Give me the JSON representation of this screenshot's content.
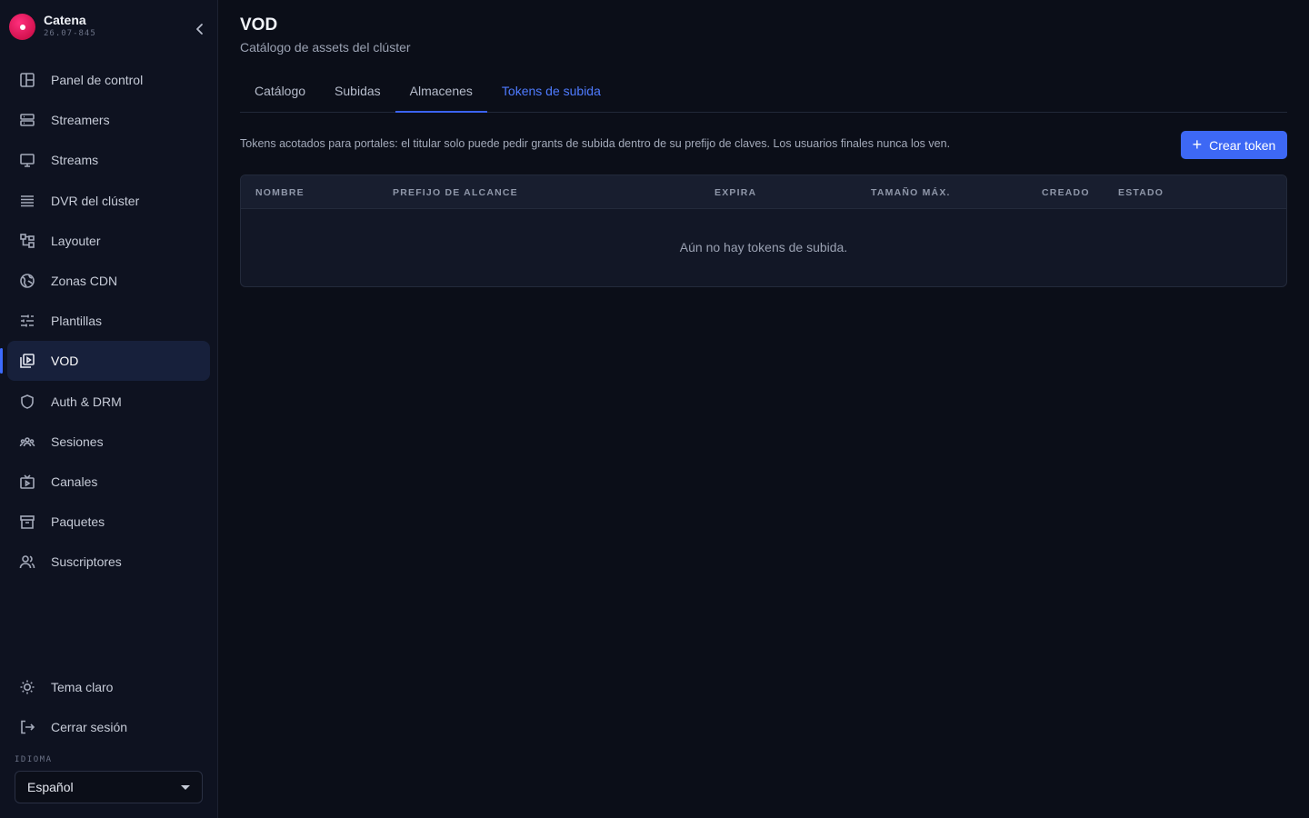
{
  "app": {
    "name": "Catena",
    "version": "26.07-845"
  },
  "sidebar": {
    "items": [
      {
        "label": "Panel de control",
        "icon": "dashboard-icon"
      },
      {
        "label": "Streamers",
        "icon": "server-icon"
      },
      {
        "label": "Streams",
        "icon": "monitor-icon"
      },
      {
        "label": "DVR del clúster",
        "icon": "storage-icon"
      },
      {
        "label": "Layouter",
        "icon": "layout-icon"
      },
      {
        "label": "Zonas CDN",
        "icon": "globe-icon"
      },
      {
        "label": "Plantillas",
        "icon": "sliders-icon"
      },
      {
        "label": "VOD",
        "icon": "video-library-icon",
        "active": true
      },
      {
        "label": "Auth & DRM",
        "icon": "shield-icon"
      },
      {
        "label": "Sesiones",
        "icon": "users-group-icon"
      },
      {
        "label": "Canales",
        "icon": "tv-icon"
      },
      {
        "label": "Paquetes",
        "icon": "archive-icon"
      },
      {
        "label": "Suscriptores",
        "icon": "people-icon"
      }
    ],
    "bottom": [
      {
        "label": "Tema claro",
        "icon": "sun-icon"
      },
      {
        "label": "Cerrar sesión",
        "icon": "logout-icon"
      }
    ],
    "language_label": "IDIOMA",
    "language_value": "Español"
  },
  "main": {
    "title": "VOD",
    "subtitle": "Catálogo de assets del clúster",
    "tabs": [
      {
        "label": "Catálogo"
      },
      {
        "label": "Subidas"
      },
      {
        "label": "Almacenes"
      },
      {
        "label": "Tokens de subida"
      }
    ],
    "description": "Tokens acotados para portales: el titular solo puede pedir grants de subida dentro de su prefijo de claves. Los usuarios finales nunca los ven.",
    "create_button": "Crear token",
    "table": {
      "columns": [
        "NOMBRE",
        "PREFIJO DE ALCANCE",
        "EXPIRA",
        "TAMAÑO MÁX.",
        "CREADO",
        "ESTADO"
      ],
      "empty_message": "Aún no hay tokens de subida."
    }
  },
  "colors": {
    "accent": "#3d68f5",
    "active_tab": "#4f7bff",
    "brand": "#e0195a",
    "background": "#0b0e18"
  }
}
